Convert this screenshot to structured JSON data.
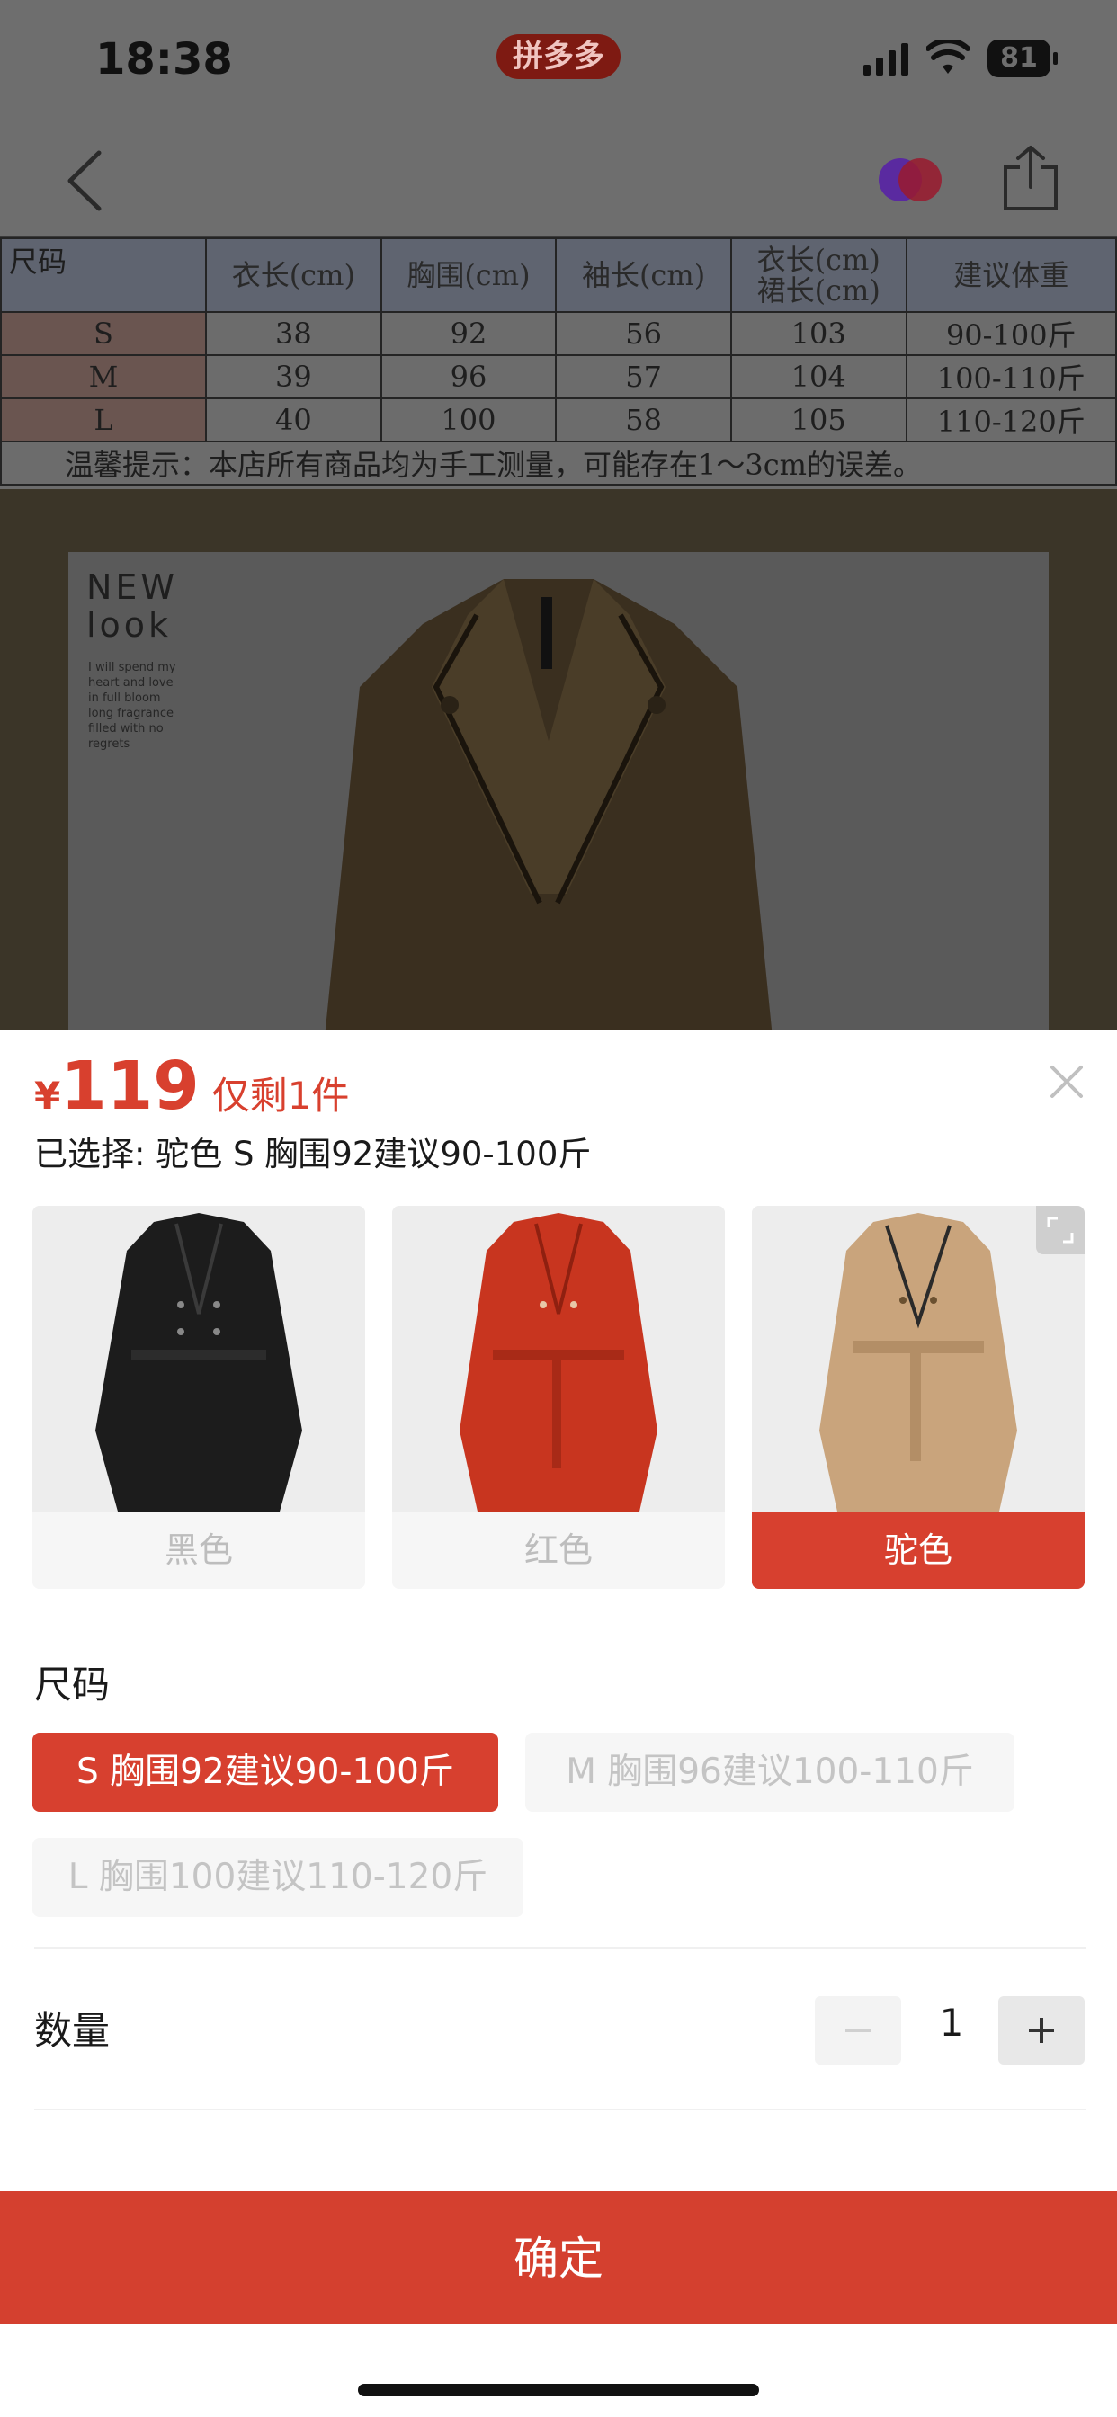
{
  "status_bar": {
    "time": "18:38",
    "app_badge": "拼多多",
    "battery": "81",
    "icons": [
      "signal-icon",
      "wifi-icon",
      "battery-icon"
    ]
  },
  "nav": {
    "icons": [
      "back-icon",
      "avatar-icon",
      "share-icon"
    ]
  },
  "size_chart": {
    "header_corner": "尺码",
    "header_faded": [
      "衣长(cm)",
      "胸围(cm)",
      "袖长(cm)",
      "衣长(cm)",
      "建议体重"
    ],
    "header_faded_sub": "裙长(cm)",
    "rows": [
      {
        "size": "S",
        "v1": "38",
        "v2": "92",
        "v3": "56",
        "v4": "103",
        "v5": "90-100斤"
      },
      {
        "size": "M",
        "v1": "39",
        "v2": "96",
        "v3": "57",
        "v4": "104",
        "v5": "100-110斤"
      },
      {
        "size": "L",
        "v1": "40",
        "v2": "100",
        "v3": "58",
        "v4": "105",
        "v5": "110-120斤"
      }
    ],
    "note": "温馨提示：本店所有商品均为手工测量，可能存在1～3cm的误差。"
  },
  "photo": {
    "title": "NEW\nlook",
    "sub": "I will spend my heart and love in full bloom long fragrance filled with no regrets"
  },
  "sheet": {
    "currency": "¥",
    "price": "119",
    "stock_note": "仅剩1件",
    "selected_text": "已选择: 驼色 S 胸围92建议90-100斤",
    "colors": [
      {
        "label": "黑色",
        "coat_color": "#1c1c1c"
      },
      {
        "label": "红色",
        "coat_color": "#c8351f"
      },
      {
        "label": "驼色",
        "coat_color": "#c9a47c"
      }
    ],
    "size_title": "尺码",
    "sizes": [
      "S 胸围92建议90-100斤",
      "M 胸围96建议100-110斤",
      "L 胸围100建议110-120斤"
    ],
    "qty_title": "数量",
    "qty_value": "1",
    "confirm": "确定",
    "accent_color": "#d7402f"
  }
}
